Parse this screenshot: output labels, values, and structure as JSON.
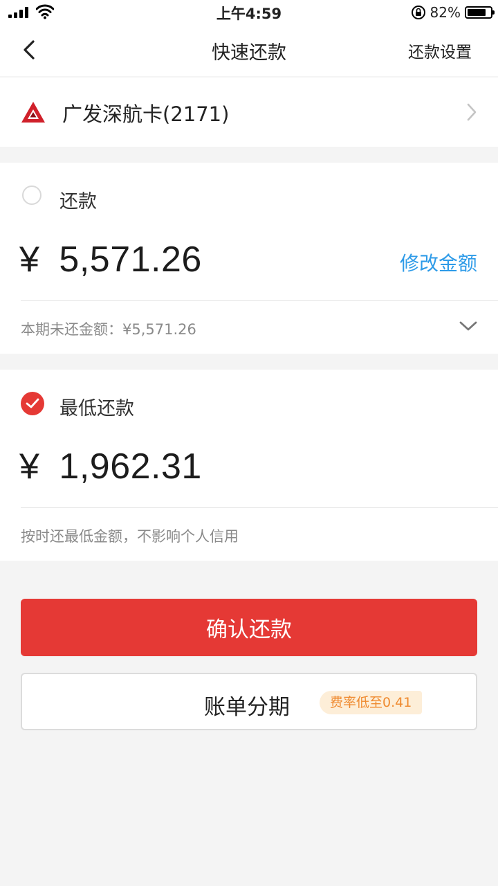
{
  "status_bar": {
    "time": "上午4:59",
    "battery_percent": "82%",
    "battery_level": 0.82
  },
  "nav": {
    "title": "快速还款",
    "right_label": "还款设置"
  },
  "card": {
    "name": "广发深航卡(2171)",
    "logo_color": "#d0202a"
  },
  "option_full": {
    "label": "还款",
    "selected": false,
    "currency": "¥",
    "amount": "5,571.26",
    "edit_label": "修改金额",
    "note": "本期未还金额：¥5,571.26"
  },
  "option_min": {
    "label": "最低还款",
    "selected": true,
    "currency": "¥",
    "amount": "1,962.31",
    "note": "按时还最低金额，不影响个人信用"
  },
  "actions": {
    "confirm_label": "确认还款",
    "installment_label": "账单分期",
    "installment_badge": "费率低至0.41"
  },
  "colors": {
    "accent_red": "#e53935",
    "link_blue": "#2e9be8",
    "badge_bg": "#fdeed8",
    "badge_text": "#ef8a2f"
  }
}
